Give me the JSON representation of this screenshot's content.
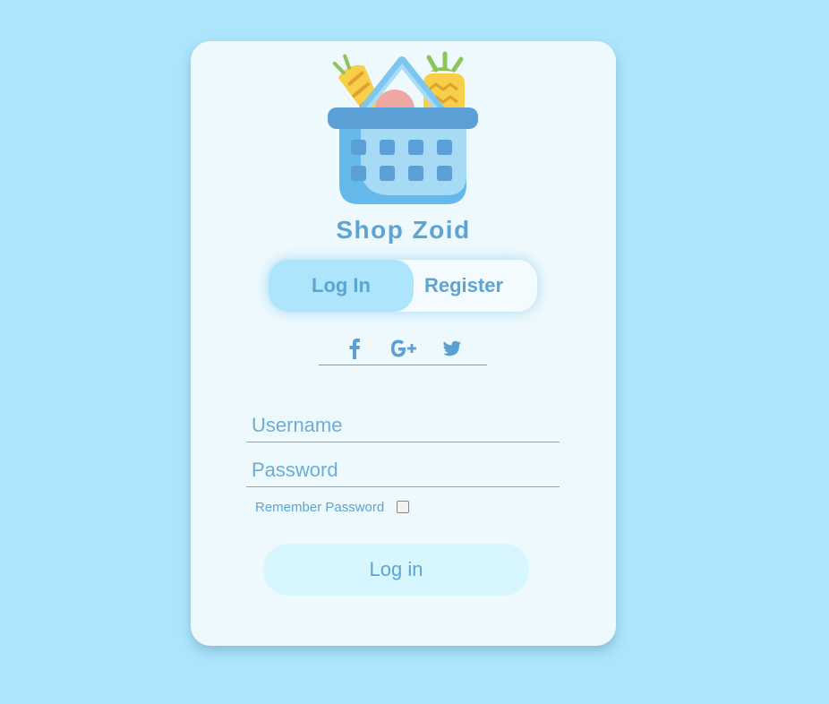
{
  "app": {
    "brand_name": "Shop Zoid",
    "logo_icon": "shopping-basket-icon"
  },
  "auth_tabs": {
    "login_label": "Log In",
    "register_label": "Register",
    "active": "login"
  },
  "social": {
    "icons": [
      "facebook-icon",
      "google-plus-icon",
      "twitter-icon"
    ]
  },
  "form": {
    "username_placeholder": "Username",
    "username_value": "",
    "password_placeholder": "Password",
    "password_value": "",
    "remember_label": "Remember Password",
    "remember_checked": false,
    "submit_label": "Log in"
  },
  "colors": {
    "background": "#ace5fc",
    "card": "#eef9fd",
    "accent": "#5ba4d4",
    "active_tab": "#ace5fc",
    "button": "#d8f6fd"
  }
}
